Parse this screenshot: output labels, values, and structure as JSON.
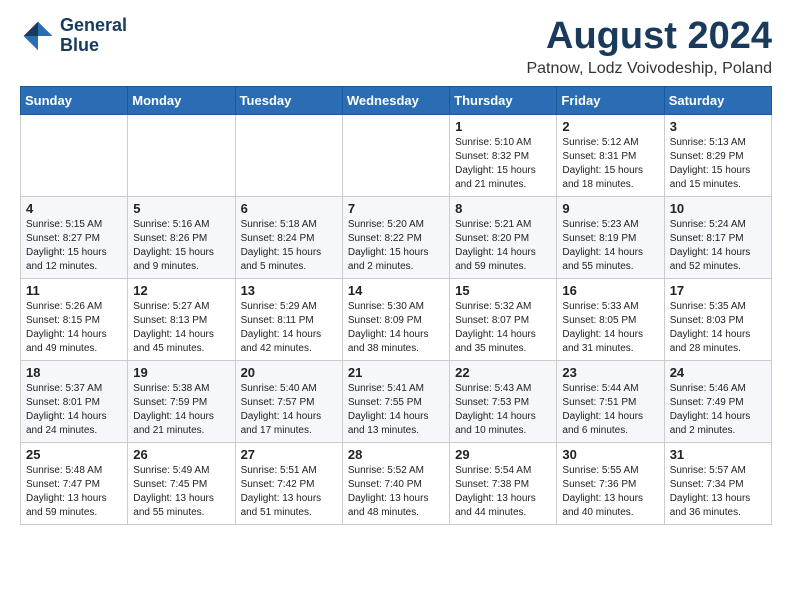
{
  "header": {
    "logo_line1": "General",
    "logo_line2": "Blue",
    "month_year": "August 2024",
    "location": "Patnow, Lodz Voivodeship, Poland"
  },
  "weekdays": [
    "Sunday",
    "Monday",
    "Tuesday",
    "Wednesday",
    "Thursday",
    "Friday",
    "Saturday"
  ],
  "weeks": [
    [
      {
        "day": "",
        "info": ""
      },
      {
        "day": "",
        "info": ""
      },
      {
        "day": "",
        "info": ""
      },
      {
        "day": "",
        "info": ""
      },
      {
        "day": "1",
        "info": "Sunrise: 5:10 AM\nSunset: 8:32 PM\nDaylight: 15 hours\nand 21 minutes."
      },
      {
        "day": "2",
        "info": "Sunrise: 5:12 AM\nSunset: 8:31 PM\nDaylight: 15 hours\nand 18 minutes."
      },
      {
        "day": "3",
        "info": "Sunrise: 5:13 AM\nSunset: 8:29 PM\nDaylight: 15 hours\nand 15 minutes."
      }
    ],
    [
      {
        "day": "4",
        "info": "Sunrise: 5:15 AM\nSunset: 8:27 PM\nDaylight: 15 hours\nand 12 minutes."
      },
      {
        "day": "5",
        "info": "Sunrise: 5:16 AM\nSunset: 8:26 PM\nDaylight: 15 hours\nand 9 minutes."
      },
      {
        "day": "6",
        "info": "Sunrise: 5:18 AM\nSunset: 8:24 PM\nDaylight: 15 hours\nand 5 minutes."
      },
      {
        "day": "7",
        "info": "Sunrise: 5:20 AM\nSunset: 8:22 PM\nDaylight: 15 hours\nand 2 minutes."
      },
      {
        "day": "8",
        "info": "Sunrise: 5:21 AM\nSunset: 8:20 PM\nDaylight: 14 hours\nand 59 minutes."
      },
      {
        "day": "9",
        "info": "Sunrise: 5:23 AM\nSunset: 8:19 PM\nDaylight: 14 hours\nand 55 minutes."
      },
      {
        "day": "10",
        "info": "Sunrise: 5:24 AM\nSunset: 8:17 PM\nDaylight: 14 hours\nand 52 minutes."
      }
    ],
    [
      {
        "day": "11",
        "info": "Sunrise: 5:26 AM\nSunset: 8:15 PM\nDaylight: 14 hours\nand 49 minutes."
      },
      {
        "day": "12",
        "info": "Sunrise: 5:27 AM\nSunset: 8:13 PM\nDaylight: 14 hours\nand 45 minutes."
      },
      {
        "day": "13",
        "info": "Sunrise: 5:29 AM\nSunset: 8:11 PM\nDaylight: 14 hours\nand 42 minutes."
      },
      {
        "day": "14",
        "info": "Sunrise: 5:30 AM\nSunset: 8:09 PM\nDaylight: 14 hours\nand 38 minutes."
      },
      {
        "day": "15",
        "info": "Sunrise: 5:32 AM\nSunset: 8:07 PM\nDaylight: 14 hours\nand 35 minutes."
      },
      {
        "day": "16",
        "info": "Sunrise: 5:33 AM\nSunset: 8:05 PM\nDaylight: 14 hours\nand 31 minutes."
      },
      {
        "day": "17",
        "info": "Sunrise: 5:35 AM\nSunset: 8:03 PM\nDaylight: 14 hours\nand 28 minutes."
      }
    ],
    [
      {
        "day": "18",
        "info": "Sunrise: 5:37 AM\nSunset: 8:01 PM\nDaylight: 14 hours\nand 24 minutes."
      },
      {
        "day": "19",
        "info": "Sunrise: 5:38 AM\nSunset: 7:59 PM\nDaylight: 14 hours\nand 21 minutes."
      },
      {
        "day": "20",
        "info": "Sunrise: 5:40 AM\nSunset: 7:57 PM\nDaylight: 14 hours\nand 17 minutes."
      },
      {
        "day": "21",
        "info": "Sunrise: 5:41 AM\nSunset: 7:55 PM\nDaylight: 14 hours\nand 13 minutes."
      },
      {
        "day": "22",
        "info": "Sunrise: 5:43 AM\nSunset: 7:53 PM\nDaylight: 14 hours\nand 10 minutes."
      },
      {
        "day": "23",
        "info": "Sunrise: 5:44 AM\nSunset: 7:51 PM\nDaylight: 14 hours\nand 6 minutes."
      },
      {
        "day": "24",
        "info": "Sunrise: 5:46 AM\nSunset: 7:49 PM\nDaylight: 14 hours\nand 2 minutes."
      }
    ],
    [
      {
        "day": "25",
        "info": "Sunrise: 5:48 AM\nSunset: 7:47 PM\nDaylight: 13 hours\nand 59 minutes."
      },
      {
        "day": "26",
        "info": "Sunrise: 5:49 AM\nSunset: 7:45 PM\nDaylight: 13 hours\nand 55 minutes."
      },
      {
        "day": "27",
        "info": "Sunrise: 5:51 AM\nSunset: 7:42 PM\nDaylight: 13 hours\nand 51 minutes."
      },
      {
        "day": "28",
        "info": "Sunrise: 5:52 AM\nSunset: 7:40 PM\nDaylight: 13 hours\nand 48 minutes."
      },
      {
        "day": "29",
        "info": "Sunrise: 5:54 AM\nSunset: 7:38 PM\nDaylight: 13 hours\nand 44 minutes."
      },
      {
        "day": "30",
        "info": "Sunrise: 5:55 AM\nSunset: 7:36 PM\nDaylight: 13 hours\nand 40 minutes."
      },
      {
        "day": "31",
        "info": "Sunrise: 5:57 AM\nSunset: 7:34 PM\nDaylight: 13 hours\nand 36 minutes."
      }
    ]
  ]
}
